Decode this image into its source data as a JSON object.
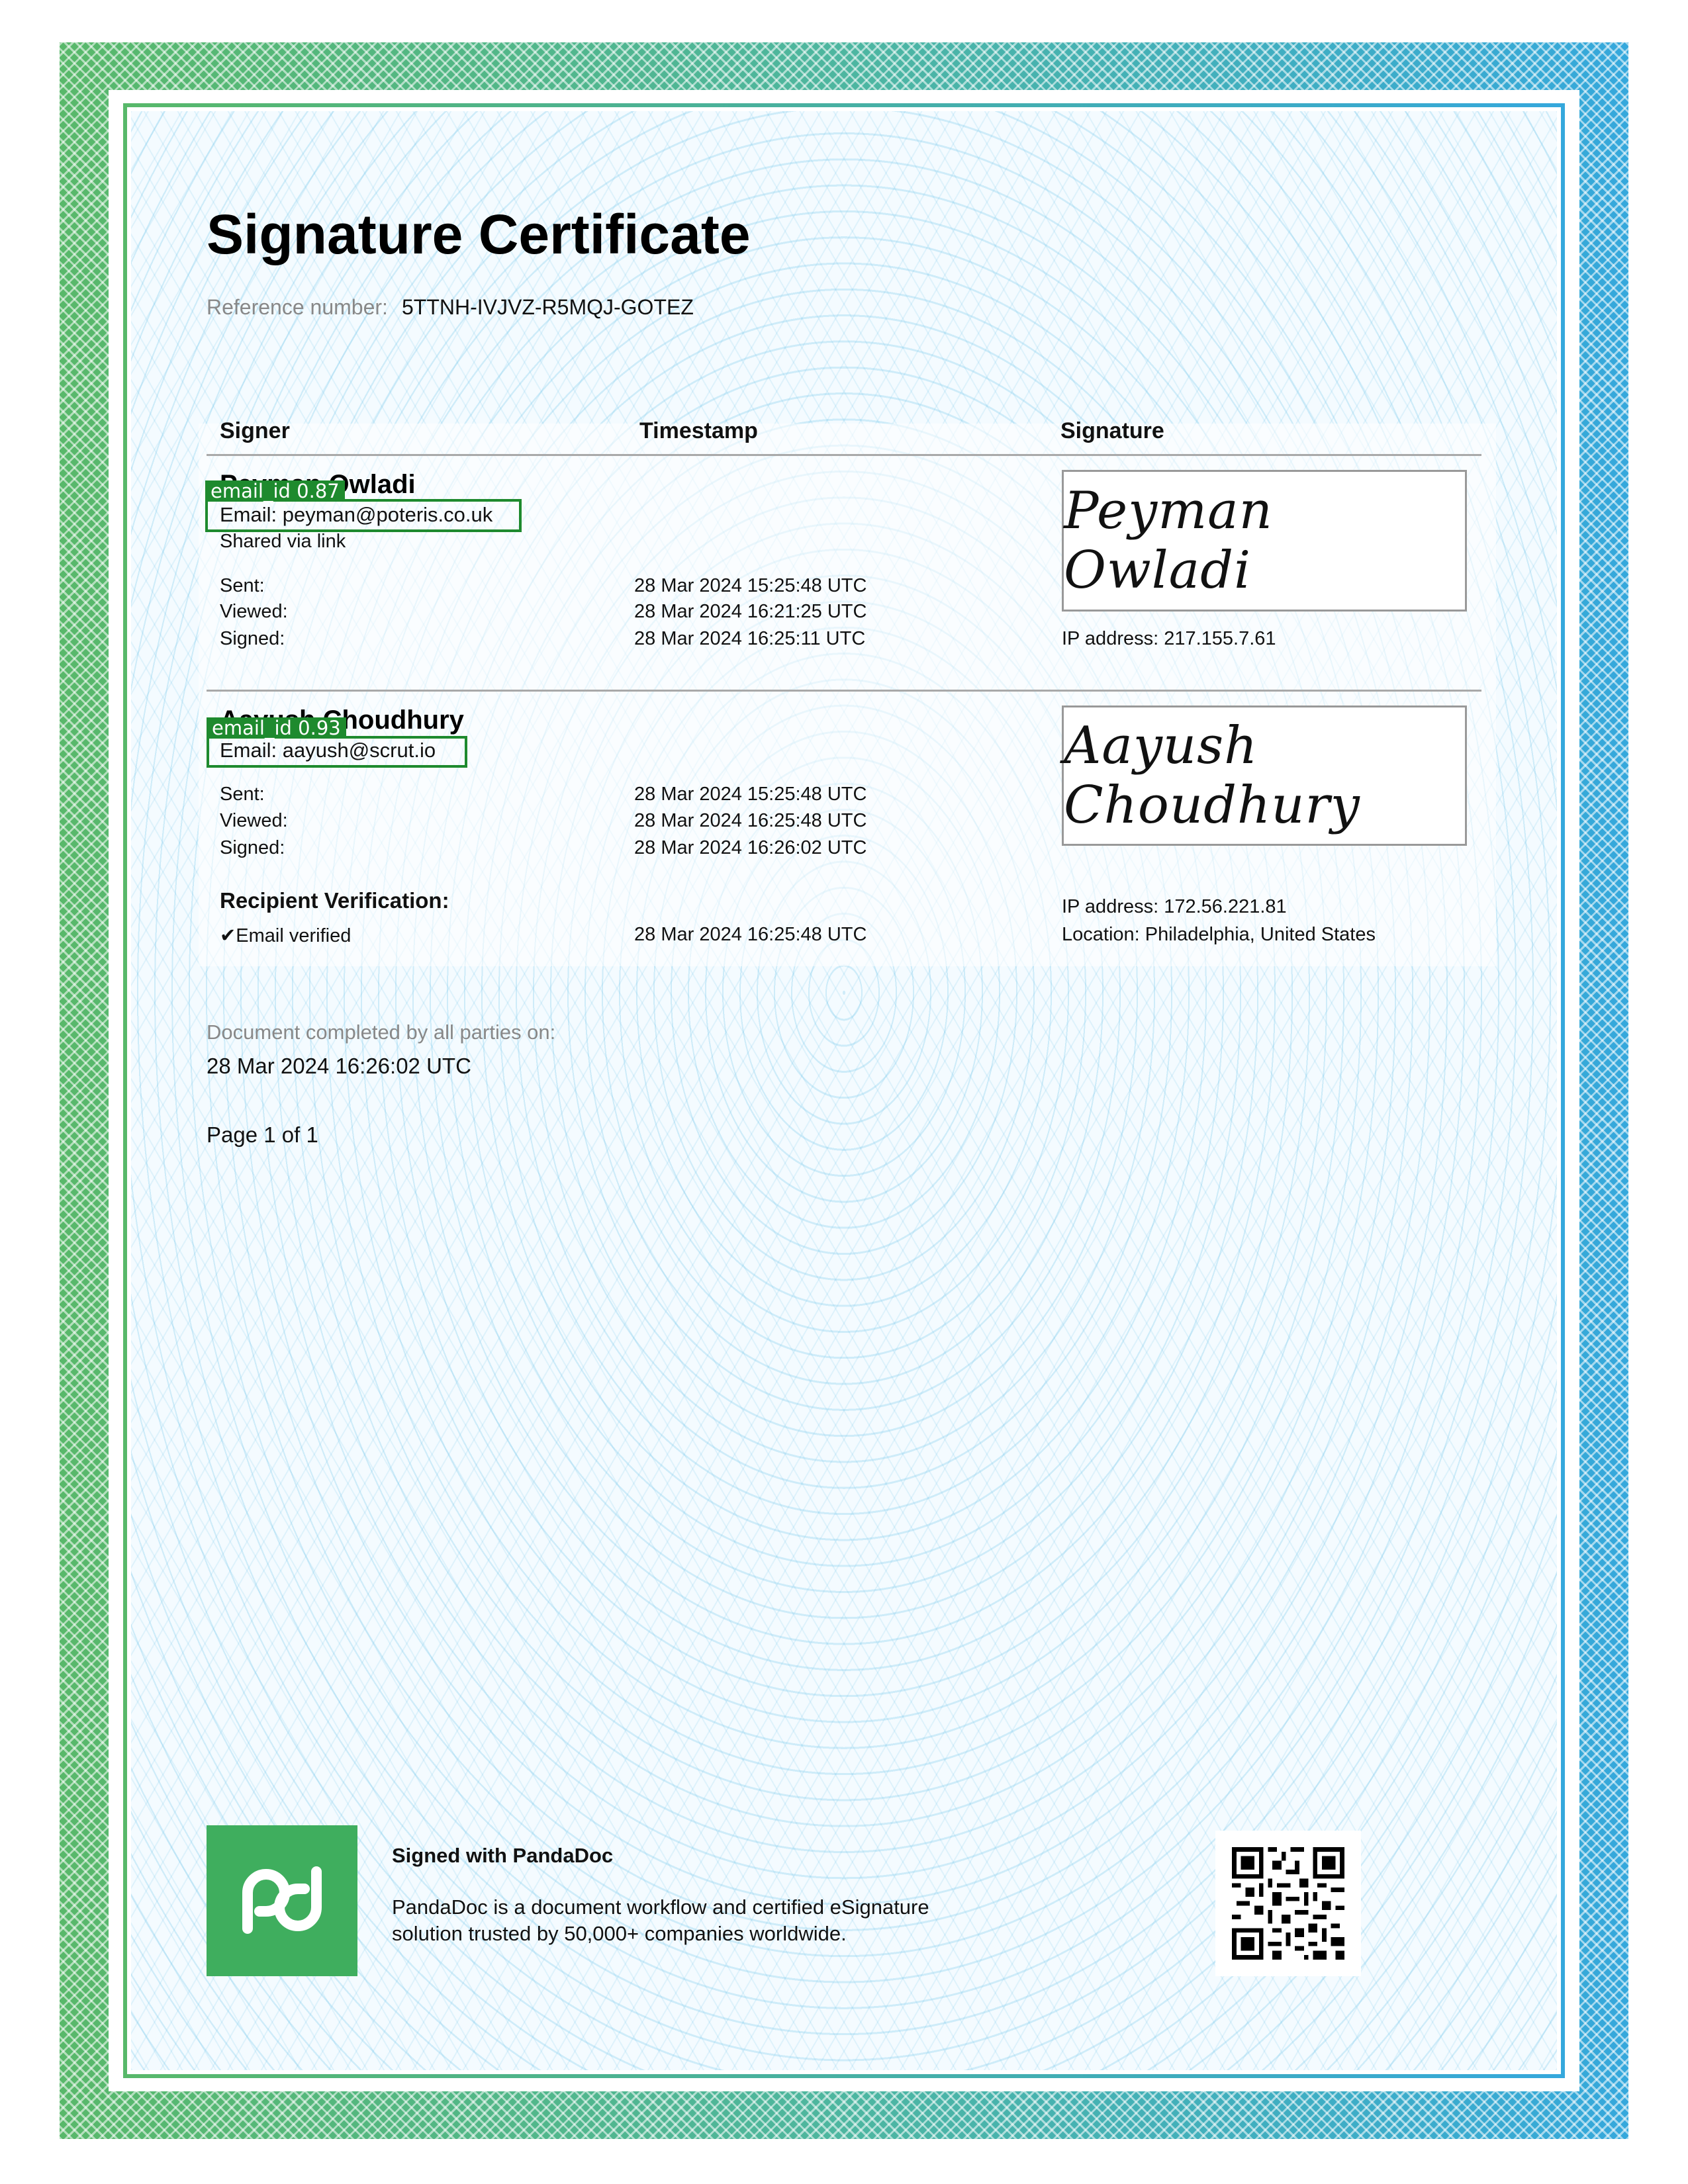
{
  "certificate": {
    "title": "Signature Certificate",
    "reference_label": "Reference number:",
    "reference_number": "5TTNH-IVJVZ-R5MQJ-GOTEZ"
  },
  "columns": {
    "signer": "Signer",
    "timestamp": "Timestamp",
    "signature": "Signature"
  },
  "signers": [
    {
      "name": "Peyman Owladi",
      "email_line": "Email: peyman@poteris.co.uk",
      "shared_via": "Shared via link",
      "events": [
        {
          "label": "Sent:",
          "time": "28 Mar 2024 15:25:48 UTC"
        },
        {
          "label": "Viewed:",
          "time": "28 Mar 2024 16:21:25 UTC"
        },
        {
          "label": "Signed:",
          "time": "28 Mar 2024 16:25:11 UTC"
        }
      ],
      "signature_text": "Peyman Owladi",
      "ip_address": "IP address: 217.155.7.61",
      "detection": {
        "label": "email_id 0.87"
      }
    },
    {
      "name": "Aayush Choudhury",
      "email_line": "Email: aayush@scrut.io",
      "events": [
        {
          "label": "Sent:",
          "time": "28 Mar 2024 15:25:48 UTC"
        },
        {
          "label": "Viewed:",
          "time": "28 Mar 2024 16:25:48 UTC"
        },
        {
          "label": "Signed:",
          "time": "28 Mar 2024 16:26:02 UTC"
        }
      ],
      "signature_text": "Aayush Choudhury",
      "ip_address": "IP address: 172.56.221.81",
      "location": "Location: Philadelphia, United States",
      "verification_heading": "Recipient Verification:",
      "verification_item": "✔Email verified",
      "verification_time": "28 Mar 2024 16:25:48 UTC",
      "detection": {
        "label": "email_id 0.93"
      }
    }
  ],
  "completion": {
    "label": "Document completed by all parties on:",
    "value": "28 Mar 2024 16:26:02 UTC",
    "page": "Page 1 of 1"
  },
  "footer": {
    "heading": "Signed with PandaDoc",
    "line1": "PandaDoc is a document workflow and certified eSignature",
    "line2": "solution trusted by 50,000+ companies worldwide."
  },
  "icons": {
    "logo": "pandadoc-logo-icon",
    "qr": "qr-code-icon"
  },
  "colors": {
    "detection": "#1e8a2e",
    "brand_green": "#3fae5e",
    "frame_blue": "#35a8dc"
  }
}
